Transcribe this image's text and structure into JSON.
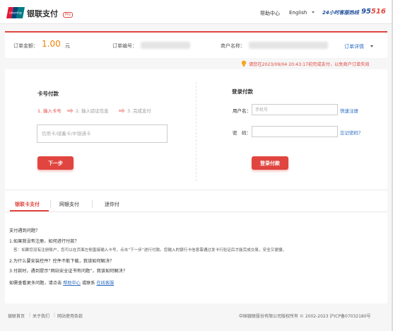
{
  "header": {
    "brand": "银联支付",
    "beta": "Pro",
    "help": "帮助中心",
    "language": "English",
    "hotline_label": "24小时客服热线",
    "hotline_prefix": "95",
    "hotline_suffix": "516"
  },
  "order": {
    "amount_label": "订单金额：",
    "amount": "1.00",
    "currency": "元",
    "order_no_label": "订单编号：",
    "merchant_label": "商户名称：",
    "detail_link": "订单详情"
  },
  "warning": "请您在2023/09/04 20:43:17前完成支付，以免商户订单失效",
  "card_pay": {
    "title": "卡号付款",
    "step1": "1. 输入卡号",
    "step2": "2. 输入验证信息",
    "step3": "3. 完成支付",
    "card_placeholder": "信用卡/储蓄卡/中银通卡",
    "next_button": "下一步"
  },
  "login_pay": {
    "title": "登录付款",
    "user_label": "用户名：",
    "user_placeholder": "手机号",
    "register_link": "快速注册",
    "password_label": "密　码：",
    "forgot_link": "忘记密码？",
    "login_button": "登录付款"
  },
  "tabs": [
    {
      "label": "银联卡支付"
    },
    {
      "label": "网银支付"
    },
    {
      "label": "迷你付"
    }
  ],
  "faq": {
    "title": "支付遇到问题？",
    "q1": "1.如果我没有注册，如何进行付款？",
    "a1": "答：如果您没有注册账户，您可以在页面左侧直接输入卡号，点击“下一步”进行付款。您输入的银行卡信息需通过发卡行验证后才能完成交易，安全又便捷。",
    "q2": "2.为什么要安装控件？控件不能下载，我该如何解决？",
    "q3": "3.付款时，遇到提示“网站安全证书有问题”，我该如何解决？",
    "more_prefix": "如需查看更多问题，请点击",
    "help_center": "帮助中心",
    "or_contact": "或联系",
    "online_service": "在线客服"
  },
  "footer": {
    "links": [
      "银联首页",
      "关于我们",
      "网站使用条款"
    ],
    "copyright": "中国银联股份有限公司版权所有 © 2002-2023  沪ICP备07032180号"
  },
  "colors": {
    "accent": "#e0463f",
    "link": "#2b6cc4",
    "amount": "#f08200",
    "brand_blue": "#1f4e9b"
  }
}
